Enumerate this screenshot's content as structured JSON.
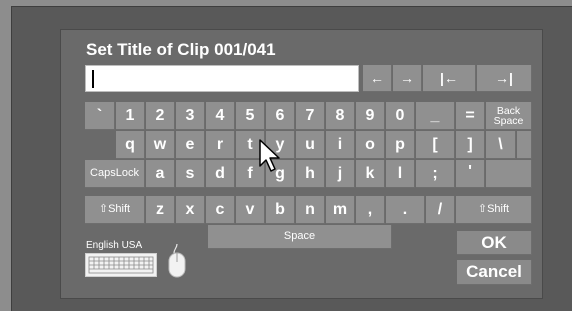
{
  "dialog": {
    "title": "Set Title of Clip 001/041",
    "text_value": "",
    "nav_keys": [
      {
        "name": "cursor-left-key",
        "label": "←"
      },
      {
        "name": "cursor-right-key",
        "label": "→"
      },
      {
        "name": "cursor-home-key",
        "label": "|←"
      },
      {
        "name": "cursor-end-key",
        "label": "→|"
      }
    ],
    "rows": [
      [
        "`",
        "1",
        "2",
        "3",
        "4",
        "5",
        "6",
        "7",
        "8",
        "9",
        "0",
        "_",
        "="
      ],
      [
        "q",
        "w",
        "e",
        "r",
        "t",
        "y",
        "u",
        "i",
        "o",
        "p",
        "[",
        "]",
        "\\"
      ],
      [
        "a",
        "s",
        "d",
        "f",
        "g",
        "h",
        "j",
        "k",
        "l",
        ";",
        "'"
      ],
      [
        "z",
        "x",
        "c",
        "v",
        "b",
        "n",
        "m",
        ",",
        ".",
        "/"
      ]
    ],
    "backspace_label": "Back Space",
    "capslock_label": "CapsLock",
    "shift_label": "⇧Shift",
    "space_label": "Space",
    "language_label": "English USA",
    "ok_label": "OK",
    "cancel_label": "Cancel",
    "icons": [
      "keyboard-icon",
      "mouse-icon",
      "pointer-cursor-icon"
    ]
  }
}
